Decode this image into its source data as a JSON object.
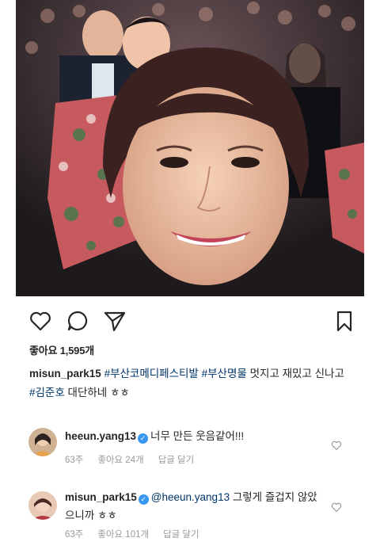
{
  "post": {
    "likes_label": "좋아요 1,595개",
    "caption": {
      "username": "misun_park15",
      "parts": [
        {
          "text": " ",
          "tag": false
        },
        {
          "text": "#부산코메디페스티발",
          "tag": true
        },
        {
          "text": " ",
          "tag": false
        },
        {
          "text": "#부산명물",
          "tag": true
        },
        {
          "text": "  멋지고  재밌고  신나고 ",
          "tag": false
        },
        {
          "text": "#김준호",
          "tag": true
        },
        {
          "text": " 대단하네 ㅎㅎ",
          "tag": false
        }
      ]
    }
  },
  "comments": [
    {
      "username": "heeun.yang13",
      "verified": true,
      "mention": "",
      "text": "너무 만든 웃음같어!!!",
      "time": "63주",
      "likes": "좋아요 24개",
      "reply": "답글 달기"
    },
    {
      "username": "misun_park15",
      "verified": true,
      "mention": "@heeun.yang13",
      "text": " 그렇게 즐겁지 않았으니까 ㅎㅎ",
      "time": "63주",
      "likes": "좋아요 101개",
      "reply": "답글 달기"
    }
  ],
  "icons": {
    "like": "heart-outline-icon",
    "comment": "speech-bubble-icon",
    "share": "paper-plane-icon",
    "save": "bookmark-icon"
  },
  "colors": {
    "hashtag": "#003569",
    "verified": "#3897f0",
    "meta": "#999999"
  }
}
